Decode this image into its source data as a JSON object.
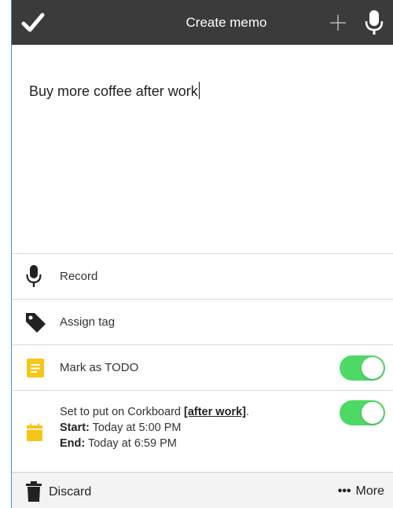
{
  "header": {
    "title": "Create memo",
    "confirm_icon": "checkmark-icon",
    "add_icon": "plus-icon",
    "voice_icon": "microphone-icon"
  },
  "memo": {
    "text": "Buy more coffee after work"
  },
  "options": {
    "record_label": "Record",
    "assign_tag_label": "Assign tag",
    "todo_label": "Mark as TODO",
    "todo_enabled": true,
    "corkboard": {
      "prefix": "Set to put on Corkboard ",
      "trigger": "[after work]",
      "suffix": ".",
      "start_label": "Start:",
      "start_value": " Today at 5:00 PM",
      "end_label": "End:",
      "end_value": " Today at 6:59 PM",
      "enabled": true
    }
  },
  "footer": {
    "discard_label": "Discard",
    "more_dots": "•••",
    "more_label": "More"
  },
  "colors": {
    "header_bg": "#3b3b3b",
    "toggle_on": "#4cd964",
    "todo_icon": "#f5c518",
    "corkboard_icon": "#f5c518",
    "accent_border": "#3d8fd6"
  }
}
